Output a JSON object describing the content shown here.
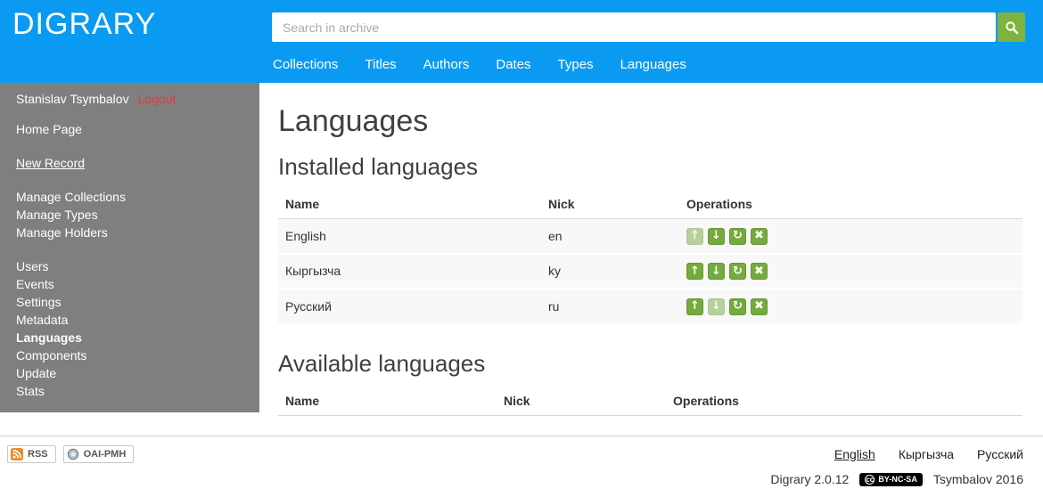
{
  "header": {
    "logo": "DIGRARY",
    "search": {
      "placeholder": "Search in archive"
    },
    "nav": [
      {
        "id": "collections",
        "label": "Collections"
      },
      {
        "id": "titles",
        "label": "Titles"
      },
      {
        "id": "authors",
        "label": "Authors"
      },
      {
        "id": "dates",
        "label": "Dates"
      },
      {
        "id": "types",
        "label": "Types"
      },
      {
        "id": "languages",
        "label": "Languages"
      }
    ]
  },
  "sidebar": {
    "user_name": "Stanislav Tsymbalov",
    "logout_label": "Logout",
    "groups": [
      {
        "items": [
          {
            "id": "home-page",
            "label": "Home Page"
          }
        ]
      },
      {
        "items": [
          {
            "id": "new-record",
            "label": "New Record",
            "underline": true
          }
        ]
      },
      {
        "items": [
          {
            "id": "manage-collections",
            "label": "Manage Collections"
          },
          {
            "id": "manage-types",
            "label": "Manage Types"
          },
          {
            "id": "manage-holders",
            "label": "Manage Holders"
          }
        ]
      },
      {
        "items": [
          {
            "id": "users",
            "label": "Users"
          },
          {
            "id": "events",
            "label": "Events"
          },
          {
            "id": "settings",
            "label": "Settings"
          },
          {
            "id": "metadata",
            "label": "Metadata"
          },
          {
            "id": "languages",
            "label": "Languages",
            "active": true
          },
          {
            "id": "components",
            "label": "Components"
          },
          {
            "id": "update",
            "label": "Update"
          },
          {
            "id": "stats",
            "label": "Stats"
          }
        ]
      }
    ]
  },
  "main": {
    "title": "Languages",
    "operations": [
      {
        "id": "move-up",
        "glyph": "↑"
      },
      {
        "id": "move-down",
        "glyph": "↓"
      },
      {
        "id": "reload",
        "glyph": "↻"
      },
      {
        "id": "delete",
        "glyph": "✖"
      }
    ],
    "installed": {
      "heading": "Installed languages",
      "columns": [
        "Name",
        "Nick",
        "Operations"
      ],
      "rows": [
        {
          "name": "English",
          "nick": "en",
          "disabled_ops": [
            "move-up"
          ]
        },
        {
          "name": "Кыргызча",
          "nick": "ky",
          "disabled_ops": []
        },
        {
          "name": "Русский",
          "nick": "ru",
          "disabled_ops": [
            "move-down"
          ]
        }
      ]
    },
    "available": {
      "heading": "Available languages",
      "columns": [
        "Name",
        "Nick",
        "Operations"
      ],
      "rows": []
    }
  },
  "footer": {
    "badges": [
      {
        "id": "rss",
        "label": "RSS"
      },
      {
        "id": "oai-pmh",
        "label": "OAI-PMH"
      }
    ],
    "languages": [
      {
        "label": "English",
        "underline": true
      },
      {
        "label": "Кыргызча",
        "underline": false
      },
      {
        "label": "Русский",
        "underline": false
      }
    ],
    "version": "Digrary 2.0.12",
    "license": "BY-NC-SA",
    "license_icon": "cc",
    "copyright": "Tsymbalov 2016"
  },
  "colors": {
    "header_blue": "#0a9af2",
    "button_green": "#74ab3c",
    "sidebar_gray": "#7f7f7f",
    "logout_red": "#e23b3b"
  }
}
